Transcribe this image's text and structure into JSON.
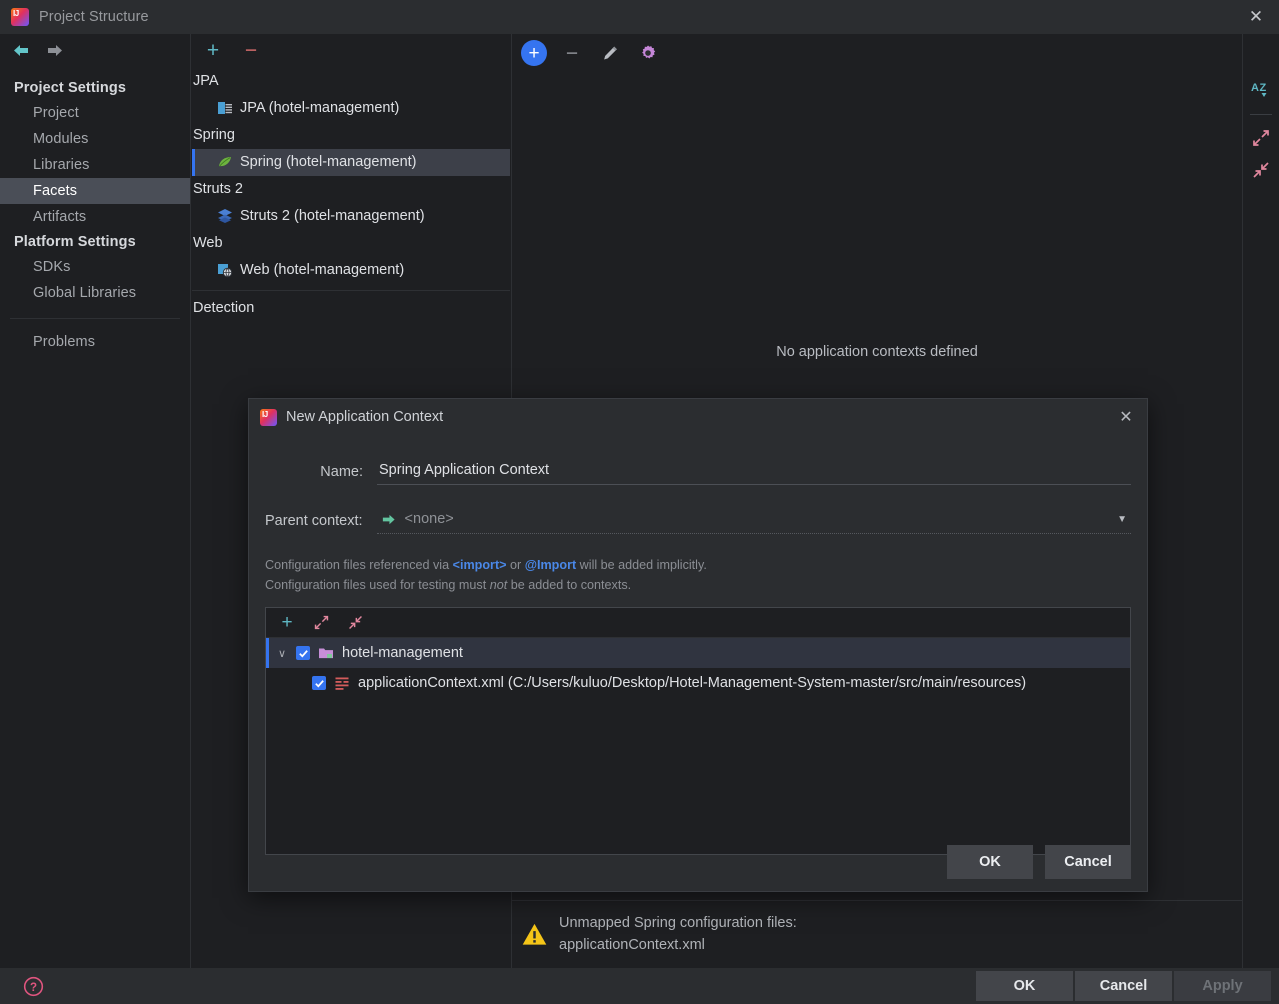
{
  "window": {
    "title": "Project Structure",
    "close_label": "✕",
    "logo_icon": "intellij-logo-icon"
  },
  "navigation": {
    "back_icon": "back-arrow-icon",
    "forward_icon": "forward-arrow-icon"
  },
  "sidebar": {
    "groups": [
      {
        "label": "Project Settings",
        "items": [
          {
            "label": "Project",
            "selected": false
          },
          {
            "label": "Modules",
            "selected": false
          },
          {
            "label": "Libraries",
            "selected": false
          },
          {
            "label": "Facets",
            "selected": true
          },
          {
            "label": "Artifacts",
            "selected": false
          }
        ]
      },
      {
        "label": "Platform Settings",
        "items": [
          {
            "label": "SDKs",
            "selected": false
          },
          {
            "label": "Global Libraries",
            "selected": false
          }
        ]
      }
    ],
    "problems_label": "Problems"
  },
  "facets": {
    "toolbar": {
      "add_label": "+",
      "remove_label": "−"
    },
    "groups": [
      {
        "label": "JPA",
        "node": "JPA (hotel-management)",
        "icon": "jpa-facet-icon",
        "selected": false
      },
      {
        "label": "Spring",
        "node": "Spring (hotel-management)",
        "icon": "spring-leaf-icon",
        "selected": true
      },
      {
        "label": "Struts 2",
        "node": "Struts 2 (hotel-management)",
        "icon": "struts2-facet-icon",
        "selected": false
      },
      {
        "label": "Web",
        "node": "Web (hotel-management)",
        "icon": "web-facet-icon",
        "selected": false
      }
    ],
    "detection_label": "Detection"
  },
  "content": {
    "toolbar": {
      "add_label": "+",
      "remove_label": "−",
      "edit_icon": "pencil-edit-icon",
      "settings_icon": "gear-settings-icon"
    },
    "empty_message": "No application contexts defined",
    "warning": {
      "icon": "warning-triangle-icon",
      "line1": "Unmapped Spring configuration files:",
      "line2": "applicationContext.xml"
    }
  },
  "vertical_toolbar": {
    "sort_icon": "sort-alphabetically-icon",
    "sort_label": "AZ",
    "expand_icon": "expand-all-icon",
    "collapse_icon": "collapse-all-icon"
  },
  "bottom_bar": {
    "help_icon": "help-question-icon",
    "buttons": [
      {
        "label": "OK",
        "enabled": true
      },
      {
        "label": "Cancel",
        "enabled": true
      },
      {
        "label": "Apply",
        "enabled": false
      }
    ]
  },
  "modal": {
    "title": "New Application Context",
    "close_label": "✕",
    "logo_icon": "intellij-logo-icon",
    "name_label": "Name:",
    "name_value": "Spring Application Context",
    "parent_label": "Parent context:",
    "parent_icon": "arrow-right-green-icon",
    "parent_value": "<none>",
    "caret_icon": "chevron-down-icon",
    "hint": {
      "line1_a": "Configuration files referenced via ",
      "line1_code1": "<import>",
      "line1_b": " or ",
      "line1_code2": "@Import",
      "line1_c": " will be added implicitly.",
      "line2_a": "Configuration files used for testing must ",
      "line2_em": "not",
      "line2_b": " be added to contexts."
    },
    "tree_toolbar": {
      "add_label": "+",
      "expand_icon": "expand-all-icon",
      "collapse_icon": "collapse-all-icon"
    },
    "tree": [
      {
        "label": "hotel-management",
        "icon": "module-folder-icon",
        "checked": true,
        "expanded": true,
        "selected": true,
        "twisty": "∨"
      },
      {
        "label": "applicationContext.xml (C:/Users/kuluo/Desktop/Hotel-Management-System-master/src/main/resources)",
        "icon": "spring-xml-file-icon",
        "checked": true,
        "selected": false
      }
    ],
    "buttons": [
      {
        "label": "OK"
      },
      {
        "label": "Cancel"
      }
    ]
  },
  "colors": {
    "accent_blue": "#3574f0",
    "teal": "#5fb7c4",
    "red": "#cf6a6a",
    "warning_yellow": "#f5c518",
    "link_blue": "#4a88e8",
    "selection_gray": "#4a4e57"
  }
}
